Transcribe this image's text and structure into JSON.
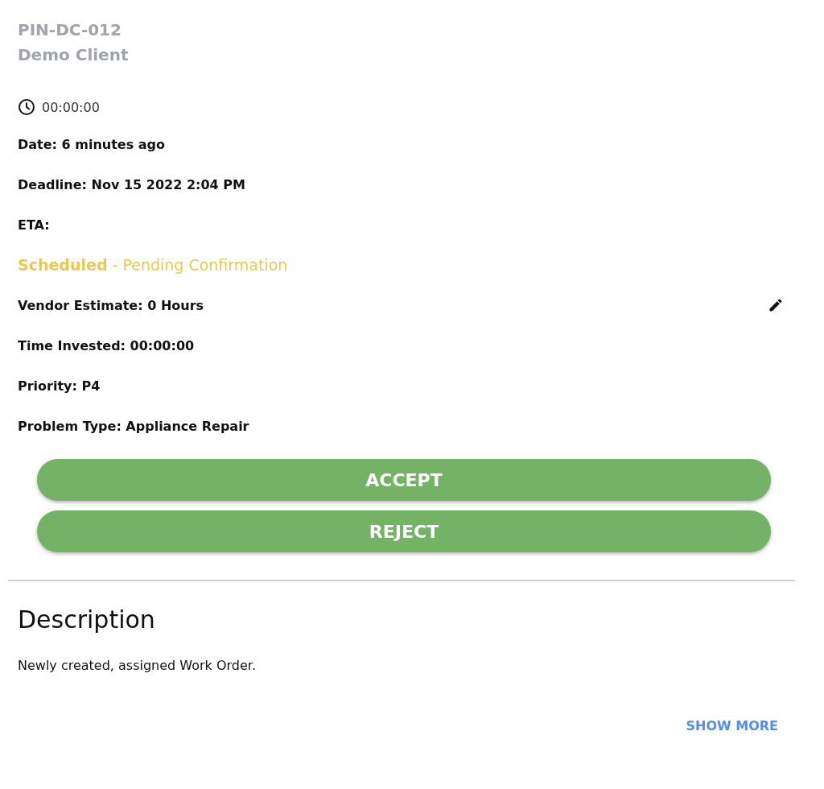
{
  "header": {
    "code": "PIN-DC-012",
    "client": "Demo Client"
  },
  "timer": "00:00:00",
  "meta": [
    {
      "text": "Date: 6 minutes ago"
    },
    {
      "text": "Deadline: Nov 15 2022 2:04 PM"
    },
    {
      "text": "ETA:"
    }
  ],
  "status": "**Scheduled** - Pending Confirmation",
  "details": [
    {
      "text": "Vendor Estimate: 0 Hours",
      "editable": true
    },
    {
      "text": "Time Invested: 00:00:00",
      "editable": false
    },
    {
      "text": "Priority: P4",
      "editable": false
    },
    {
      "text": "Problem Type: Appliance Repair",
      "editable": false
    }
  ],
  "buttons": [
    "ACCEPT",
    "REJECT"
  ],
  "description": {
    "title": "Description",
    "text": "Newly created, assigned Work Order.",
    "link": "SHOW MORE"
  }
}
